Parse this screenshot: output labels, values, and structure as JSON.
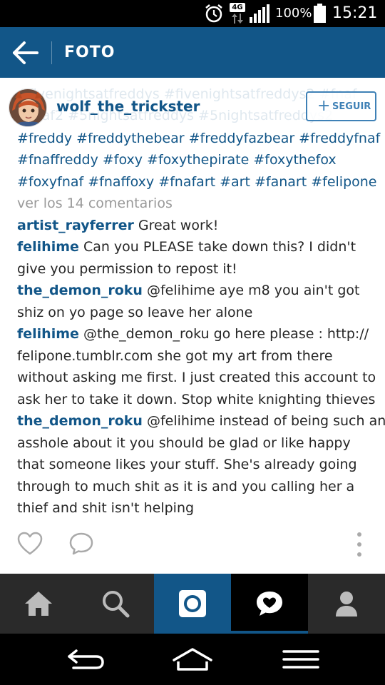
{
  "status_bar": {
    "network": "4G",
    "battery": "100%",
    "time": "15:21"
  },
  "app_bar": {
    "title": "FOTO"
  },
  "post": {
    "username": "wolf_the_trickster",
    "follow_label": "SEGUIR",
    "ghost_lines": [
      "#fivenightsatfreddys #fivenightsatfreddys2 #fnaf",
      "#fnaf2 #5nightsatfreddys #5nightsatfreddys2"
    ],
    "hashtag_lines": [
      "#freddy #freddythebear #freddyfazbear #freddyfnaf",
      "#fnaffreddy #foxy #foxythepirate #foxythefox",
      "#foxyfnaf #fnaffoxy #fnafart #art #fanart #felipone"
    ],
    "view_comments": "ver los 14 comentarios"
  },
  "comments": [
    {
      "user": "artist_rayferrer",
      "lines": [
        " Great work!"
      ]
    },
    {
      "user": "felihime",
      "lines": [
        " Can you PLEASE take down this? I didn't",
        "give you permission to repost it!"
      ]
    },
    {
      "user": "the_demon_roku",
      "lines": [
        " @felihime aye m8 you ain't got",
        "shiz on yo page so leave her alone"
      ]
    },
    {
      "user": "felihime",
      "lines": [
        " @the_demon_roku go here please : http://",
        "felipone.tumblr.com she got my art from there",
        "without asking me first. I just created this account to",
        "ask her to take it down. Stop white knighting thieves"
      ]
    },
    {
      "user": "the_demon_roku",
      "lines": [
        " @felihime instead of being such an",
        "asshole about it you should be glad or like happy",
        "that someone likes your stuff. She's already going",
        "through to much shit as it is and you calling her a",
        "thief and shit isn't helping"
      ]
    }
  ],
  "colors": {
    "brand": "#125688",
    "text": "#262626",
    "muted": "#999999",
    "tab_bg": "#2a2a2a"
  },
  "icons": {
    "back": "arrow-left-icon",
    "like": "heart-outline-icon",
    "comment": "speech-bubble-icon",
    "more": "vertical-ellipsis-icon",
    "tabs": [
      "home-icon",
      "search-icon",
      "camera-icon",
      "activity-heart-bubble-icon",
      "profile-icon"
    ],
    "nav": [
      "back-nav-icon",
      "home-nav-icon",
      "menu-nav-icon"
    ]
  }
}
